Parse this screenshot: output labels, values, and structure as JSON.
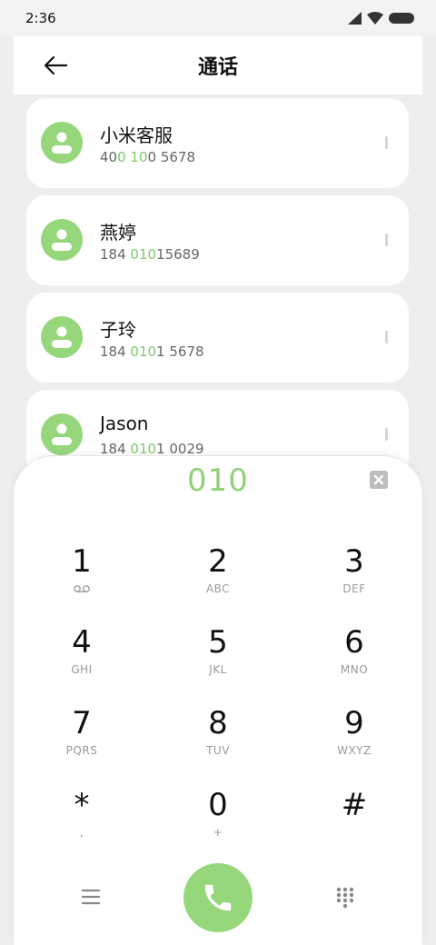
{
  "status": {
    "time": "2:36"
  },
  "header": {
    "title": "通话"
  },
  "contacts": [
    {
      "name": "小米客服",
      "num_parts": [
        "40",
        "0",
        " ",
        "10",
        "0 5678"
      ]
    },
    {
      "name": "燕婷",
      "num_parts": [
        "184 ",
        "010",
        "",
        "",
        "15689"
      ]
    },
    {
      "name": "子玲",
      "num_parts": [
        "184 ",
        "010",
        "",
        "",
        "1 5678"
      ]
    },
    {
      "name": "Jason",
      "num_parts": [
        "184 ",
        "010",
        "",
        "",
        "1 0029"
      ]
    }
  ],
  "dialpad": {
    "dialed_number": "010",
    "keys": [
      {
        "digit": "1",
        "letters": ""
      },
      {
        "digit": "2",
        "letters": "ABC"
      },
      {
        "digit": "3",
        "letters": "DEF"
      },
      {
        "digit": "4",
        "letters": "GHI"
      },
      {
        "digit": "5",
        "letters": "JKL"
      },
      {
        "digit": "6",
        "letters": "MNO"
      },
      {
        "digit": "7",
        "letters": "PQRS"
      },
      {
        "digit": "8",
        "letters": "TUV"
      },
      {
        "digit": "9",
        "letters": "WXYZ"
      },
      {
        "digit": "*",
        "letters": ","
      },
      {
        "digit": "0",
        "letters": "+"
      },
      {
        "digit": "#",
        "letters": ""
      }
    ]
  },
  "colors": {
    "accent": "#96d77c",
    "highlight": "#7dc96a",
    "background": "#eeeeee"
  },
  "icons": {
    "back": "arrow-left-icon",
    "voicemail": "voicemail-icon",
    "clear": "backspace-icon",
    "menu": "hamburger-icon",
    "call": "phone-icon",
    "dialpad_toggle": "dialpad-icon"
  }
}
